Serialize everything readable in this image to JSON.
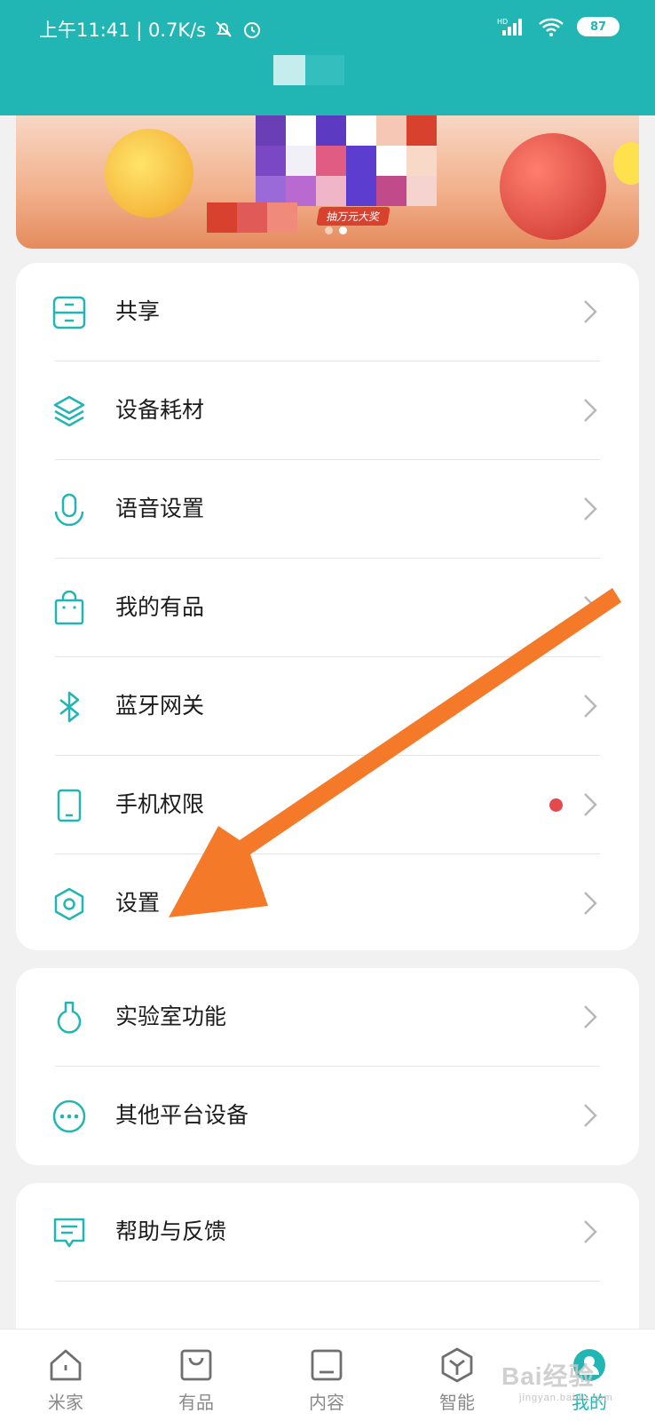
{
  "status_bar": {
    "time_text": "上午11:41 | 0.7K/s",
    "network": "HD",
    "battery": "87",
    "icons": [
      "mute-bell-icon",
      "alarm-icon",
      "signal-icon",
      "wifi-icon",
      "battery-icon"
    ]
  },
  "banner": {
    "tagline": "抽万元大奖",
    "page_count": 2,
    "active_page": 2
  },
  "menu_groups": [
    {
      "items": [
        {
          "label": "共享",
          "icon": "share-icon"
        },
        {
          "label": "设备耗材",
          "icon": "layers-icon"
        },
        {
          "label": "语音设置",
          "icon": "microphone-icon"
        },
        {
          "label": "我的有品",
          "icon": "shopping-bag-icon"
        },
        {
          "label": "蓝牙网关",
          "icon": "bluetooth-icon"
        },
        {
          "label": "手机权限",
          "icon": "phone-icon",
          "badge": "red-dot"
        },
        {
          "label": "设置",
          "icon": "hexagon-settings-icon"
        }
      ]
    },
    {
      "items": [
        {
          "label": "实验室功能",
          "icon": "flask-icon"
        },
        {
          "label": "其他平台设备",
          "icon": "more-dots-icon"
        }
      ]
    },
    {
      "items": [
        {
          "label": "帮助与反馈",
          "icon": "feedback-icon"
        }
      ]
    }
  ],
  "tabbar": {
    "tabs": [
      {
        "label": "米家",
        "icon": "home-icon"
      },
      {
        "label": "有品",
        "icon": "bag-icon"
      },
      {
        "label": "内容",
        "icon": "content-icon"
      },
      {
        "label": "智能",
        "icon": "cube-icon"
      },
      {
        "label": "我的",
        "icon": "profile-icon",
        "active": true
      }
    ]
  },
  "watermark": {
    "text": "Bai经验",
    "sub": "jingyan.baidu.com"
  },
  "colors": {
    "accent": "#21b5b3",
    "arrow": "#f47a2a",
    "badge": "#e5484d"
  }
}
